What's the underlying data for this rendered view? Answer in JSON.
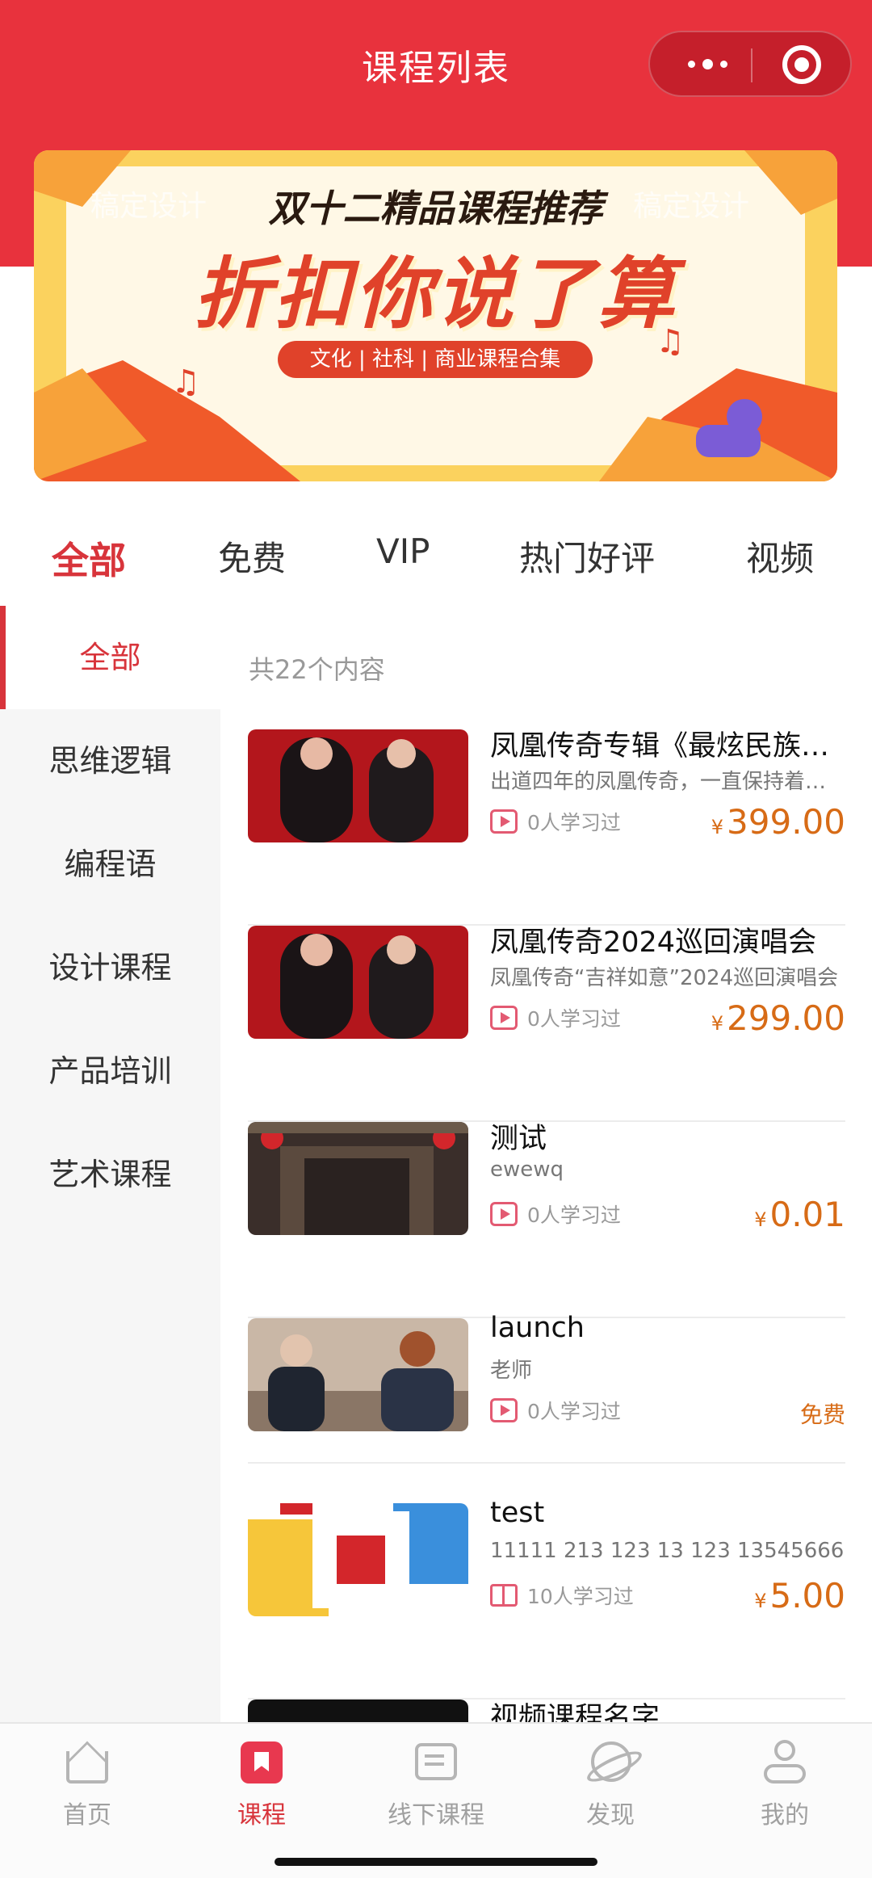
{
  "header": {
    "title": "课程列表",
    "capsule": {
      "more_icon": "more-dots-icon",
      "close_icon": "target-icon"
    },
    "background_color": "#e8323d"
  },
  "banner": {
    "watermark": "稿定设计",
    "subtitle": "双十二精品课程推荐",
    "headline": "折扣你说了算",
    "tagline": "文化 | 社科 | 商业课程合集"
  },
  "tabs": [
    {
      "label": "全部",
      "active": true
    },
    {
      "label": "免费",
      "active": false
    },
    {
      "label": "VIP",
      "active": false
    },
    {
      "label": "热门好评",
      "active": false
    },
    {
      "label": "视频",
      "active": false
    }
  ],
  "sidebar": [
    {
      "label": "全部",
      "active": true
    },
    {
      "label": "思维逻辑",
      "active": false
    },
    {
      "label": "编程语",
      "active": false
    },
    {
      "label": "设计课程",
      "active": false
    },
    {
      "label": "产品培训",
      "active": false
    },
    {
      "label": "艺术课程",
      "active": false
    }
  ],
  "list": {
    "count_text": "共22个内容",
    "currency": "¥",
    "items": [
      {
        "title": "凤凰传奇专辑《最炫民族风》",
        "desc": "出道四年的凤凰传奇，一直保持着热度",
        "learners": "0人学习过",
        "price": "399.00",
        "type_icon": "video-icon"
      },
      {
        "title": "凤凰传奇2024巡回演唱会",
        "desc": "凤凰传奇“吉祥如意”2024巡回演唱会",
        "learners": "0人学习过",
        "price": "299.00",
        "type_icon": "video-icon"
      },
      {
        "title": "测试",
        "desc": "ewewq",
        "learners": "0人学习过",
        "price": "0.01",
        "type_icon": "video-icon"
      },
      {
        "title": "launch",
        "desc": "老师",
        "learners": "0人学习过",
        "price_label": "免费",
        "type_icon": "video-icon"
      },
      {
        "title": "test",
        "desc": "11111 213 123 13 123 13545666",
        "learners": "10人学习过",
        "price": "5.00",
        "type_icon": "book-icon"
      },
      {
        "title": "视频课程名字",
        "desc": "",
        "learners": "",
        "price": "",
        "type_icon": "video-icon"
      }
    ]
  },
  "tabbar": [
    {
      "label": "首页",
      "icon": "home-icon",
      "active": false
    },
    {
      "label": "课程",
      "icon": "course-bookmark-icon",
      "active": true
    },
    {
      "label": "线下课程",
      "icon": "offline-course-icon",
      "active": false
    },
    {
      "label": "发现",
      "icon": "discover-planet-icon",
      "active": false
    },
    {
      "label": "我的",
      "icon": "user-icon",
      "active": false
    }
  ],
  "colors": {
    "accent": "#d8343b",
    "price": "#d76b16"
  }
}
